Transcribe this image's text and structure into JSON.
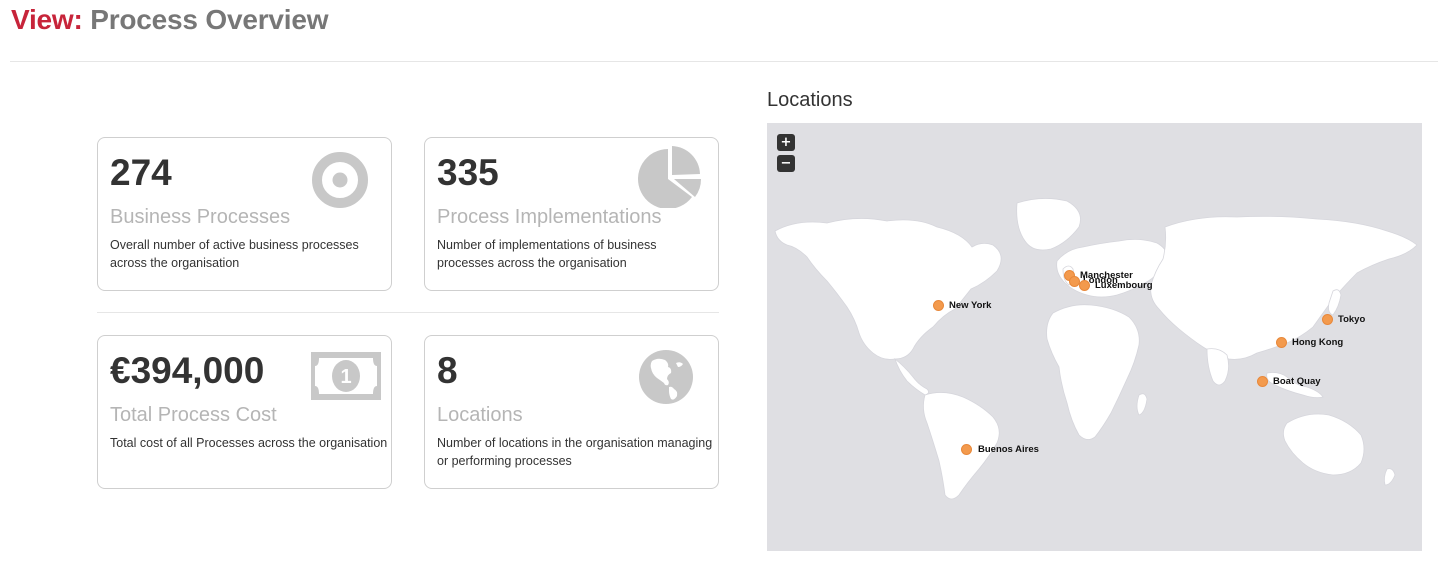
{
  "header": {
    "prefix": "View:",
    "title": "Process Overview"
  },
  "cards": [
    {
      "value": "274",
      "label": "Business Processes",
      "description": "Overall number of active business processes across the organisation",
      "icon": "target-icon"
    },
    {
      "value": "335",
      "label": "Process Implementations",
      "description": "Number of implementations of business processes across the organisation",
      "icon": "pie-chart-icon"
    },
    {
      "value": "€394,000",
      "label": "Total Process Cost",
      "description": "Total cost of all Processes across the organisation",
      "icon": "banknote-icon"
    },
    {
      "value": "8",
      "label": "Locations",
      "description": "Number of locations in the organisation managing or performing processes",
      "icon": "globe-icon"
    }
  ],
  "map": {
    "title": "Locations",
    "zoom_in": "+",
    "zoom_out": "−",
    "marker_color": "#f39a4d",
    "locations": [
      {
        "name": "Manchester"
      },
      {
        "name": "London"
      },
      {
        "name": "Luxembourg"
      },
      {
        "name": "New York"
      },
      {
        "name": "Tokyo"
      },
      {
        "name": "Hong Kong"
      },
      {
        "name": "Boat Quay"
      },
      {
        "name": "Buenos Aires"
      }
    ]
  },
  "colors": {
    "accent": "#c7243a",
    "header_title": "#777777",
    "card_label": "#b5b5b5",
    "icon": "#c8c8c8",
    "map_bg": "#dfdfe3"
  }
}
